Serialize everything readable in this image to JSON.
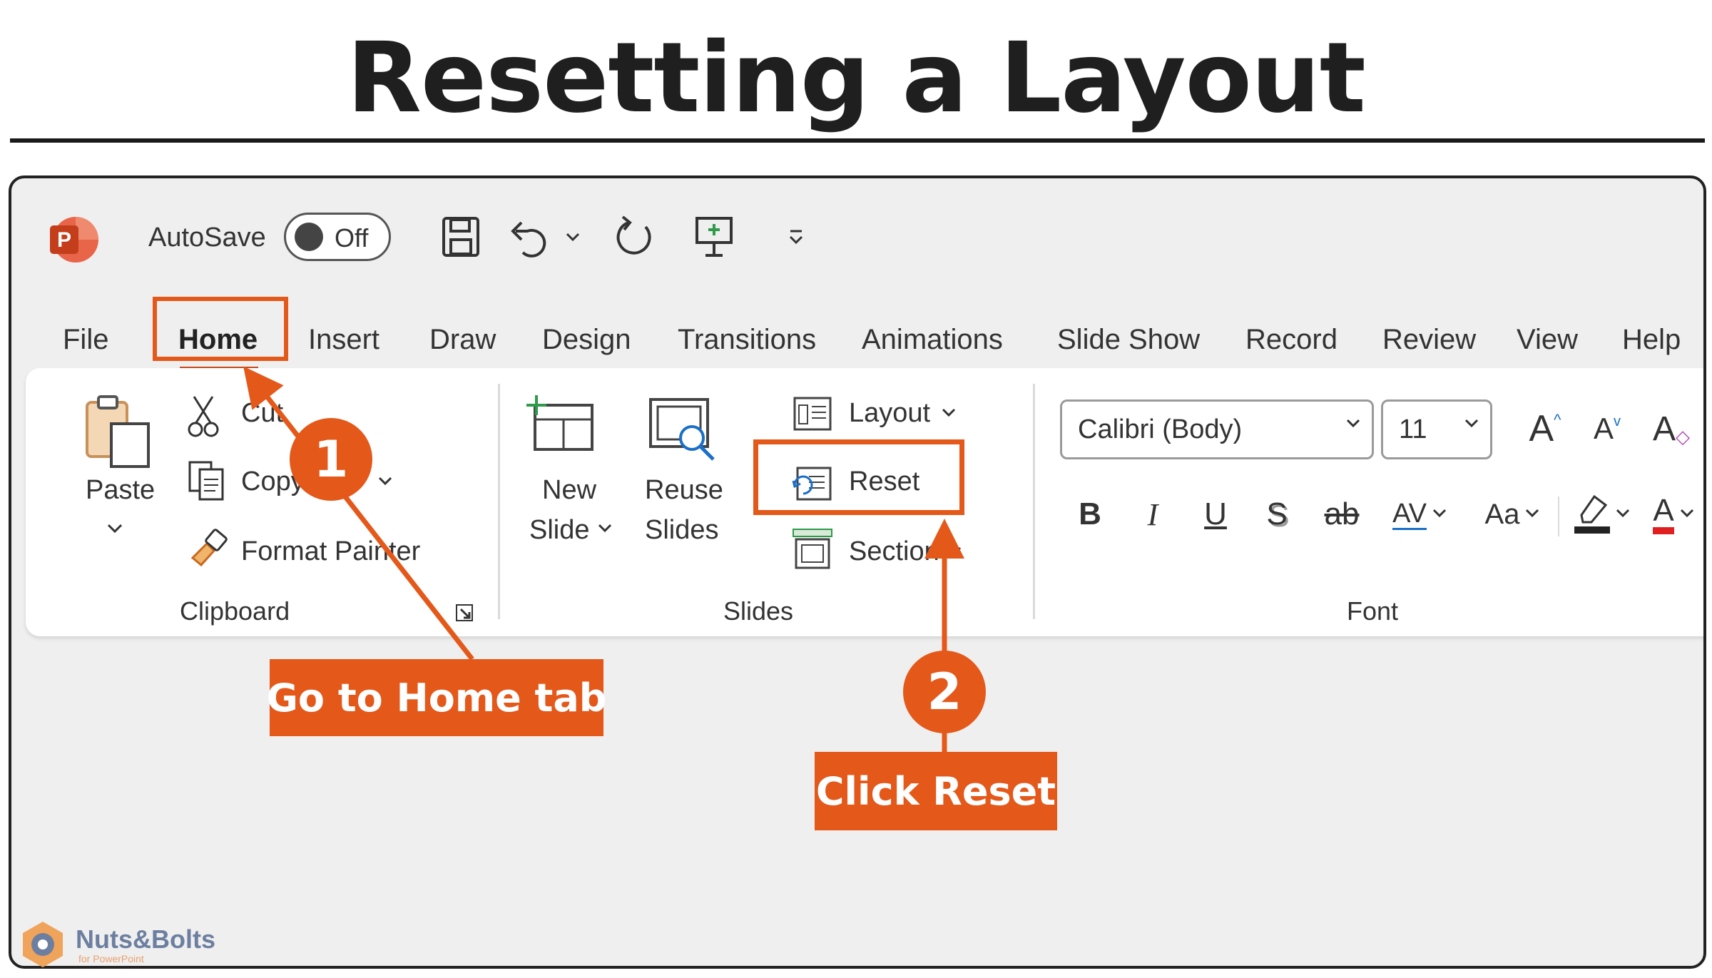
{
  "page_title": "Resetting a Layout",
  "quick_access": {
    "app_icon": "powerpoint-icon",
    "autosave_label": "AutoSave",
    "autosave_state": "Off",
    "icons": [
      "save-icon",
      "undo-icon",
      "chevron-down-icon",
      "redo-icon",
      "present-icon",
      "customize-qat-icon"
    ]
  },
  "menu": {
    "tabs": [
      "File",
      "Home",
      "Insert",
      "Draw",
      "Design",
      "Transitions",
      "Animations",
      "Slide Show",
      "Record",
      "Review",
      "View",
      "Help"
    ],
    "active": "Home"
  },
  "ribbon": {
    "clipboard": {
      "label": "Clipboard",
      "paste": "Paste",
      "cut": "Cut",
      "copy": "Copy",
      "format_painter": "Format Painter"
    },
    "slides": {
      "label": "Slides",
      "new_slide_1": "New",
      "new_slide_2": "Slide",
      "reuse_1": "Reuse",
      "reuse_2": "Slides",
      "layout": "Layout",
      "reset": "Reset",
      "section": "Section"
    },
    "font": {
      "label": "Font",
      "font_name": "Calibri (Body)",
      "font_size": "11",
      "bold": "B",
      "italic": "I",
      "underline": "U",
      "shadow": "S",
      "strikethrough": "ab",
      "spacing": "AV",
      "case": "Aa",
      "grow": "A",
      "shrink": "A",
      "clear": "A",
      "font_color": "A"
    }
  },
  "callouts": {
    "step1_number": "1",
    "step1_text": "Go to Home tab",
    "step2_number": "2",
    "step2_text": "Click Reset"
  },
  "brand": {
    "name": "Nuts&Bolts",
    "sub": "for PowerPoint"
  },
  "colors": {
    "accent": "#e4581a",
    "powerpoint": "#d04a2a",
    "highlight_yellow": "#222222",
    "font_red": "#e02020"
  }
}
